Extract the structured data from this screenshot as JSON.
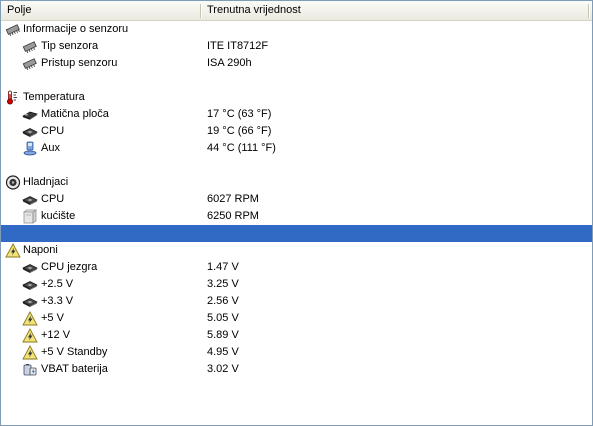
{
  "header": {
    "col_field": "Polje",
    "col_value": "Trenutna vrijednost"
  },
  "sensor_info": {
    "title": "Informacije o senzoru",
    "items": [
      {
        "label": "Tip senzora",
        "value": "ITE IT8712F",
        "icon": "chip-icon"
      },
      {
        "label": "Pristup senzoru",
        "value": "ISA 290h",
        "icon": "chip-icon"
      }
    ]
  },
  "temperature": {
    "title": "Temperatura",
    "items": [
      {
        "label": "Matična ploča",
        "value": "17 °C  (63 °F)",
        "icon": "motherboard-icon"
      },
      {
        "label": "CPU",
        "value": "19 °C  (66 °F)",
        "icon": "cpu-icon"
      },
      {
        "label": "Aux",
        "value": "44 °C  (111 °F)",
        "icon": "aux-icon"
      }
    ]
  },
  "fans": {
    "title": "Hladnjaci",
    "items": [
      {
        "label": "CPU",
        "value": "6027 RPM",
        "icon": "cpu-icon"
      },
      {
        "label": "kućište",
        "value": "6250 RPM",
        "icon": "case-icon"
      }
    ]
  },
  "voltages": {
    "title": "Naponi",
    "items": [
      {
        "label": "CPU jezgra",
        "value": "1.47 V",
        "icon": "cpu-icon"
      },
      {
        "label": "+2.5 V",
        "value": "3.25 V",
        "icon": "cpu-icon"
      },
      {
        "label": "+3.3 V",
        "value": "2.56 V",
        "icon": "cpu-icon"
      },
      {
        "label": "+5 V",
        "value": "5.05 V",
        "icon": "voltage-icon"
      },
      {
        "label": "+12 V",
        "value": "5.89 V",
        "icon": "voltage-icon"
      },
      {
        "label": "+5 V Standby",
        "value": "4.95 V",
        "icon": "voltage-icon"
      },
      {
        "label": "VBAT baterija",
        "value": "3.02 V",
        "icon": "battery-icon"
      }
    ]
  },
  "colors": {
    "selection": "#316ac5",
    "border": "#7f9db9"
  }
}
